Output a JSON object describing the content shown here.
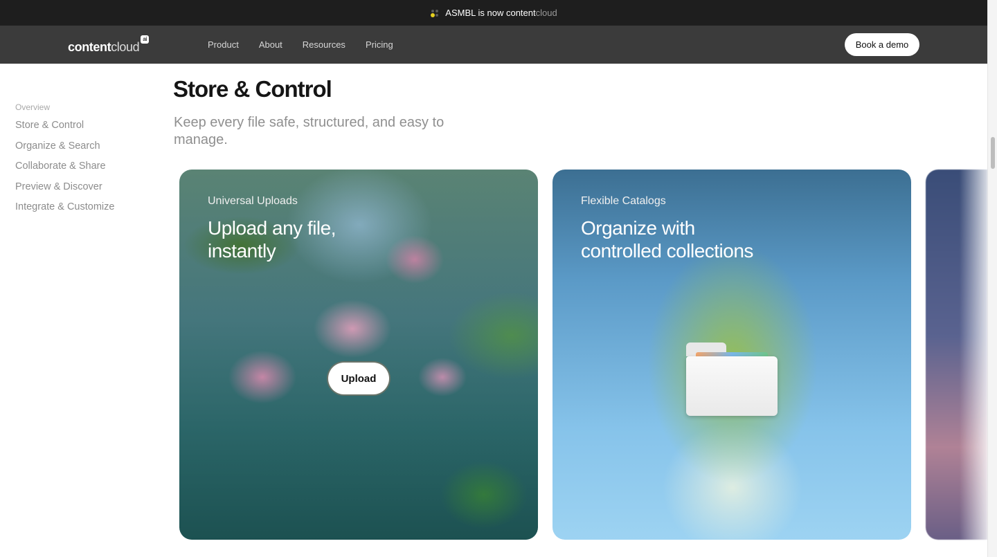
{
  "announcement": {
    "text_main": "ASMBL is now content",
    "text_cloud": "cloud",
    "icon": "dots-logo-icon"
  },
  "nav": {
    "logo_primary": "content",
    "logo_secondary": "cloud",
    "logo_badge": "ai",
    "links": [
      "Product",
      "About",
      "Resources",
      "Pricing"
    ],
    "cta": "Book a demo"
  },
  "sidebar": {
    "heading": "Overview",
    "items": [
      "Store & Control",
      "Organize & Search",
      "Collaborate & Share",
      "Preview & Discover",
      "Integrate & Customize"
    ]
  },
  "section": {
    "title": "Store & Control",
    "subtitle": "Keep every file safe, structured, and easy to manage."
  },
  "cards": [
    {
      "kicker": "Universal Uploads",
      "headline": "Upload any file, instantly",
      "button": "Upload"
    },
    {
      "kicker": "Flexible Catalogs",
      "headline": "Organize with controlled collections",
      "icon": "folder-icon"
    }
  ],
  "colors": {
    "announcement_bg": "#1e1e1e",
    "nav_bg": "#3b3b3b",
    "accent_dot": "#e6d020"
  }
}
